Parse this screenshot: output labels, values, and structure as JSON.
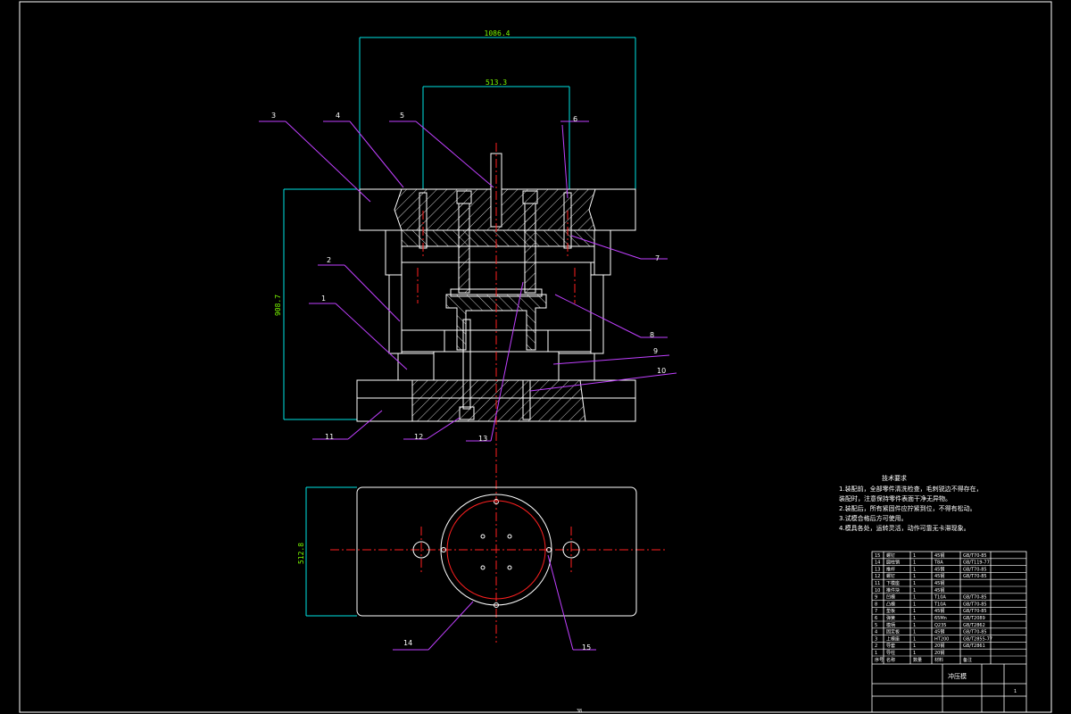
{
  "dimensions": {
    "top_width": "1086.4",
    "inner_width": "513.3",
    "height": "908.7",
    "plan_height": "512.8"
  },
  "part_labels": [
    "1",
    "2",
    "3",
    "4",
    "5",
    "6",
    "7",
    "8",
    "9",
    "10",
    "11",
    "12",
    "13",
    "14",
    "15"
  ],
  "technical_requirements": {
    "title": "技术要求",
    "items": [
      "1.装配前，全部零件清洗检查，毛刺锐边不得存在，",
      "  装配时，注意保持零件表面干净无异物。",
      "2.装配后，所有紧固件应拧紧到位，不得有松动。",
      "3.试模合格后方可使用。",
      "4.模具各处，运转灵活，动作可靠无卡滞现象。"
    ]
  },
  "bom": {
    "rows": [
      [
        "15",
        "螺钉",
        "1",
        "45钢",
        "GB/T70-85"
      ],
      [
        "14",
        "圆柱销",
        "1",
        "T8A",
        "GB/T119-77"
      ],
      [
        "13",
        "推杆",
        "1",
        "45钢",
        "GB/T70-85"
      ],
      [
        "12",
        "螺钉",
        "1",
        "45钢",
        "GB/T70-85"
      ],
      [
        "11",
        "下模座",
        "1",
        "45钢",
        ""
      ],
      [
        "10",
        "推件块",
        "1",
        "45钢",
        ""
      ],
      [
        "9",
        "凹模",
        "1",
        "T10A",
        "GB/T70-85"
      ],
      [
        "8",
        "凸模",
        "1",
        "T10A",
        "GB/T70-85"
      ],
      [
        "7",
        "垫板",
        "1",
        "45钢",
        "GB/T70-85"
      ],
      [
        "6",
        "弹簧",
        "1",
        "65Mn",
        "GB/T2089"
      ],
      [
        "5",
        "模柄",
        "1",
        "Q235",
        "GB/T2862"
      ],
      [
        "4",
        "固定板",
        "1",
        "45钢",
        "GB/T70-85"
      ],
      [
        "3",
        "上模座",
        "1",
        "HT200",
        "GB/T2855-77"
      ],
      [
        "2",
        "导套",
        "1",
        "20钢",
        "GB/T2861"
      ],
      [
        "1",
        "导柱",
        "1",
        "20钢",
        ""
      ]
    ],
    "header": [
      "序号",
      "名称",
      "数量",
      "材料",
      "备注"
    ],
    "title_block_name": "冲压模",
    "page_mark": "1"
  },
  "page_number": "38"
}
